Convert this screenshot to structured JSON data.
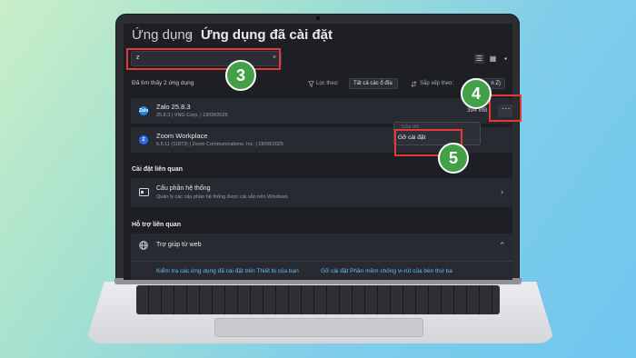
{
  "breadcrumb": {
    "root": "Ứng dụng",
    "separator": "›",
    "current": "Ứng dụng đã cài đặt"
  },
  "search": {
    "value": "z",
    "clear_glyph": "×"
  },
  "view_toggle": {
    "list": "☰",
    "grid": "▦",
    "tiles": "▪"
  },
  "results": {
    "found_text": "Đã tìm thấy 2 ứng dụng"
  },
  "filter": {
    "label": "Lọc theo:",
    "value": "Tất cả các ổ đĩa",
    "icon": "filter-icon"
  },
  "sort": {
    "label": "Sắp xếp theo:",
    "value": "n Z)",
    "icon": "sort-icon"
  },
  "apps": [
    {
      "name": "Zalo 25.8.3",
      "meta": "25.8.3  |  VNG Corp.  |  18/09/2025",
      "size": "394 MB",
      "more": "···",
      "icon_color": "#1e88e5",
      "icon_text": "Zalo"
    },
    {
      "name": "Zoom Workplace",
      "meta": "6.5.11 (11873)  |  Zoom Communications, Inc.  |  28/08/2025",
      "icon_color": "#2d6bea",
      "icon_text": "Z"
    }
  ],
  "context_menu": {
    "dim_item": "Sửa đổi",
    "uninstall": "Gỡ cài đặt"
  },
  "related_settings": {
    "heading": "Cài đặt liên quan",
    "item_title": "Cấu phần hệ thống",
    "item_sub": "Quản lý các cấu phần hệ thống được cài sẵn trên Windows",
    "chevron": "›"
  },
  "related_support": {
    "heading": "Hỗ trợ liên quan",
    "item_title": "Trợ giúp từ web",
    "chevron": "⌃",
    "links": [
      "Kiểm tra các ứng dụng đã cài đặt trên Thiết bị của bạn",
      "Gỡ cài đặt Phần mềm chống vi-rút của bên thứ ba"
    ]
  },
  "steps": [
    "3",
    "4",
    "5"
  ],
  "colors": {
    "highlight": "#e53935",
    "step_badge": "#43a047",
    "link": "#6ab8f5"
  }
}
